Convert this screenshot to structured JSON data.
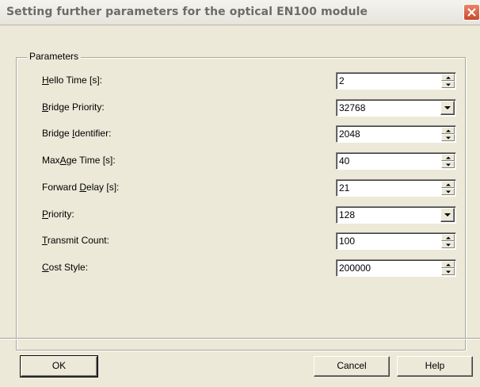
{
  "window": {
    "title": "Setting further parameters for the optical EN100 module"
  },
  "group": {
    "title": "Parameters"
  },
  "params": [
    {
      "pre": "",
      "ak": "H",
      "post": "ello Time [s]:",
      "value": "2",
      "control": "spin"
    },
    {
      "pre": "",
      "ak": "B",
      "post": "ridge Priority:",
      "value": "32768",
      "control": "dropdown"
    },
    {
      "pre": "Bridge ",
      "ak": "I",
      "post": "dentifier:",
      "value": "2048",
      "control": "spin"
    },
    {
      "pre": "Max",
      "ak": "A",
      "post": "ge Time [s]:",
      "value": "40",
      "control": "spin"
    },
    {
      "pre": "Forward ",
      "ak": "D",
      "post": "elay [s]:",
      "value": "21",
      "control": "spin"
    },
    {
      "pre": "",
      "ak": "P",
      "post": "riority:",
      "value": "128",
      "control": "dropdown"
    },
    {
      "pre": "",
      "ak": "T",
      "post": "ransmit Count:",
      "value": "100",
      "control": "spin"
    },
    {
      "pre": "",
      "ak": "C",
      "post": "ost Style:",
      "value": "200000",
      "control": "spin"
    }
  ],
  "buttons": {
    "ok": "OK",
    "cancel": "Cancel",
    "help": "Help"
  }
}
